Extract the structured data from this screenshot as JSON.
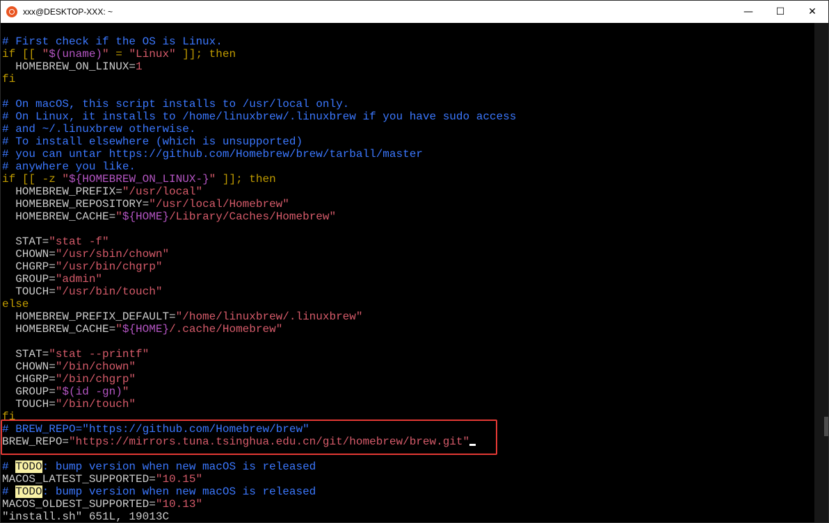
{
  "window": {
    "title": "xxx@DESKTOP-XXX: ~",
    "controls": {
      "minimize": "—",
      "maximize": "☐",
      "close": "✕"
    }
  },
  "colors": {
    "comment": "#3b78ff",
    "keyword": "#c19c00",
    "string": "#d65b6a",
    "variable": "#b455c3",
    "todo_bg": "#f9f1a5",
    "highlight_box": "#e53935"
  },
  "lines": [
    [
      {
        "t": "# First check if the OS is Linux.",
        "c": "c"
      }
    ],
    [
      {
        "t": "if [[ ",
        "c": "k"
      },
      {
        "t": "\"",
        "c": "s"
      },
      {
        "t": "$(uname)",
        "c": "m"
      },
      {
        "t": "\"",
        "c": "s"
      },
      {
        "t": " = ",
        "c": "k"
      },
      {
        "t": "\"Linux\"",
        "c": "s"
      },
      {
        "t": " ]]; then",
        "c": "k"
      }
    ],
    [
      {
        "t": "  HOMEBREW_ON_LINUX="
      },
      {
        "t": "1",
        "c": "s"
      }
    ],
    [
      {
        "t": "fi",
        "c": "k"
      }
    ],
    [
      {
        "t": ""
      }
    ],
    [
      {
        "t": "# On macOS, this script installs to /usr/local only.",
        "c": "c"
      }
    ],
    [
      {
        "t": "# On Linux, it installs to /home/linuxbrew/.linuxbrew if you have sudo access",
        "c": "c"
      }
    ],
    [
      {
        "t": "# and ~/.linuxbrew otherwise.",
        "c": "c"
      }
    ],
    [
      {
        "t": "# To install elsewhere (which is unsupported)",
        "c": "c"
      }
    ],
    [
      {
        "t": "# you can untar https://github.com/Homebrew/brew/tarball/master",
        "c": "c"
      }
    ],
    [
      {
        "t": "# anywhere you like.",
        "c": "c"
      }
    ],
    [
      {
        "t": "if [[ -z ",
        "c": "k"
      },
      {
        "t": "\"",
        "c": "s"
      },
      {
        "t": "${HOMEBREW_ON_LINUX-}",
        "c": "m"
      },
      {
        "t": "\"",
        "c": "s"
      },
      {
        "t": " ]]; then",
        "c": "k"
      }
    ],
    [
      {
        "t": "  HOMEBREW_PREFIX="
      },
      {
        "t": "\"/usr/local\"",
        "c": "s"
      }
    ],
    [
      {
        "t": "  HOMEBREW_REPOSITORY="
      },
      {
        "t": "\"/usr/local/Homebrew\"",
        "c": "s"
      }
    ],
    [
      {
        "t": "  HOMEBREW_CACHE="
      },
      {
        "t": "\"",
        "c": "s"
      },
      {
        "t": "${HOME}",
        "c": "m"
      },
      {
        "t": "/Library/Caches/Homebrew\"",
        "c": "s"
      }
    ],
    [
      {
        "t": ""
      }
    ],
    [
      {
        "t": "  STAT="
      },
      {
        "t": "\"stat -f\"",
        "c": "s"
      }
    ],
    [
      {
        "t": "  CHOWN="
      },
      {
        "t": "\"/usr/sbin/chown\"",
        "c": "s"
      }
    ],
    [
      {
        "t": "  CHGRP="
      },
      {
        "t": "\"/usr/bin/chgrp\"",
        "c": "s"
      }
    ],
    [
      {
        "t": "  GROUP="
      },
      {
        "t": "\"admin\"",
        "c": "s"
      }
    ],
    [
      {
        "t": "  TOUCH="
      },
      {
        "t": "\"/usr/bin/touch\"",
        "c": "s"
      }
    ],
    [
      {
        "t": "else",
        "c": "k"
      }
    ],
    [
      {
        "t": "  HOMEBREW_PREFIX_DEFAULT="
      },
      {
        "t": "\"/home/linuxbrew/.linuxbrew\"",
        "c": "s"
      }
    ],
    [
      {
        "t": "  HOMEBREW_CACHE="
      },
      {
        "t": "\"",
        "c": "s"
      },
      {
        "t": "${HOME}",
        "c": "m"
      },
      {
        "t": "/.cache/Homebrew\"",
        "c": "s"
      }
    ],
    [
      {
        "t": ""
      }
    ],
    [
      {
        "t": "  STAT="
      },
      {
        "t": "\"stat --printf\"",
        "c": "s"
      }
    ],
    [
      {
        "t": "  CHOWN="
      },
      {
        "t": "\"/bin/chown\"",
        "c": "s"
      }
    ],
    [
      {
        "t": "  CHGRP="
      },
      {
        "t": "\"/bin/chgrp\"",
        "c": "s"
      }
    ],
    [
      {
        "t": "  GROUP="
      },
      {
        "t": "\"",
        "c": "s"
      },
      {
        "t": "$(id -gn)",
        "c": "m"
      },
      {
        "t": "\"",
        "c": "s"
      }
    ],
    [
      {
        "t": "  TOUCH="
      },
      {
        "t": "\"/bin/touch\"",
        "c": "s"
      }
    ],
    [
      {
        "t": "fi",
        "c": "k"
      }
    ],
    [
      {
        "t": "# BREW_REPO=\"https://github.com/Homebrew/brew\"",
        "c": "c"
      }
    ],
    [
      {
        "t": "BREW_REPO="
      },
      {
        "t": "\"https://mirrors.tuna.tsinghua.edu.cn/git/homebrew/brew.git\"",
        "c": "s"
      },
      {
        "t": "",
        "cursor": true
      }
    ],
    [
      {
        "t": ""
      }
    ],
    [
      {
        "t": "# ",
        "c": "c"
      },
      {
        "t": "TODO",
        "c": "t"
      },
      {
        "t": ": bump version when new macOS is released",
        "c": "c"
      }
    ],
    [
      {
        "t": "MACOS_LATEST_SUPPORTED="
      },
      {
        "t": "\"10.15\"",
        "c": "s"
      }
    ],
    [
      {
        "t": "# ",
        "c": "c"
      },
      {
        "t": "TODO",
        "c": "t"
      },
      {
        "t": ": bump version when new macOS is released",
        "c": "c"
      }
    ],
    [
      {
        "t": "MACOS_OLDEST_SUPPORTED="
      },
      {
        "t": "\"10.13\"",
        "c": "s"
      }
    ],
    [
      {
        "t": "\"install.sh\" 651L, 19013C"
      }
    ]
  ]
}
